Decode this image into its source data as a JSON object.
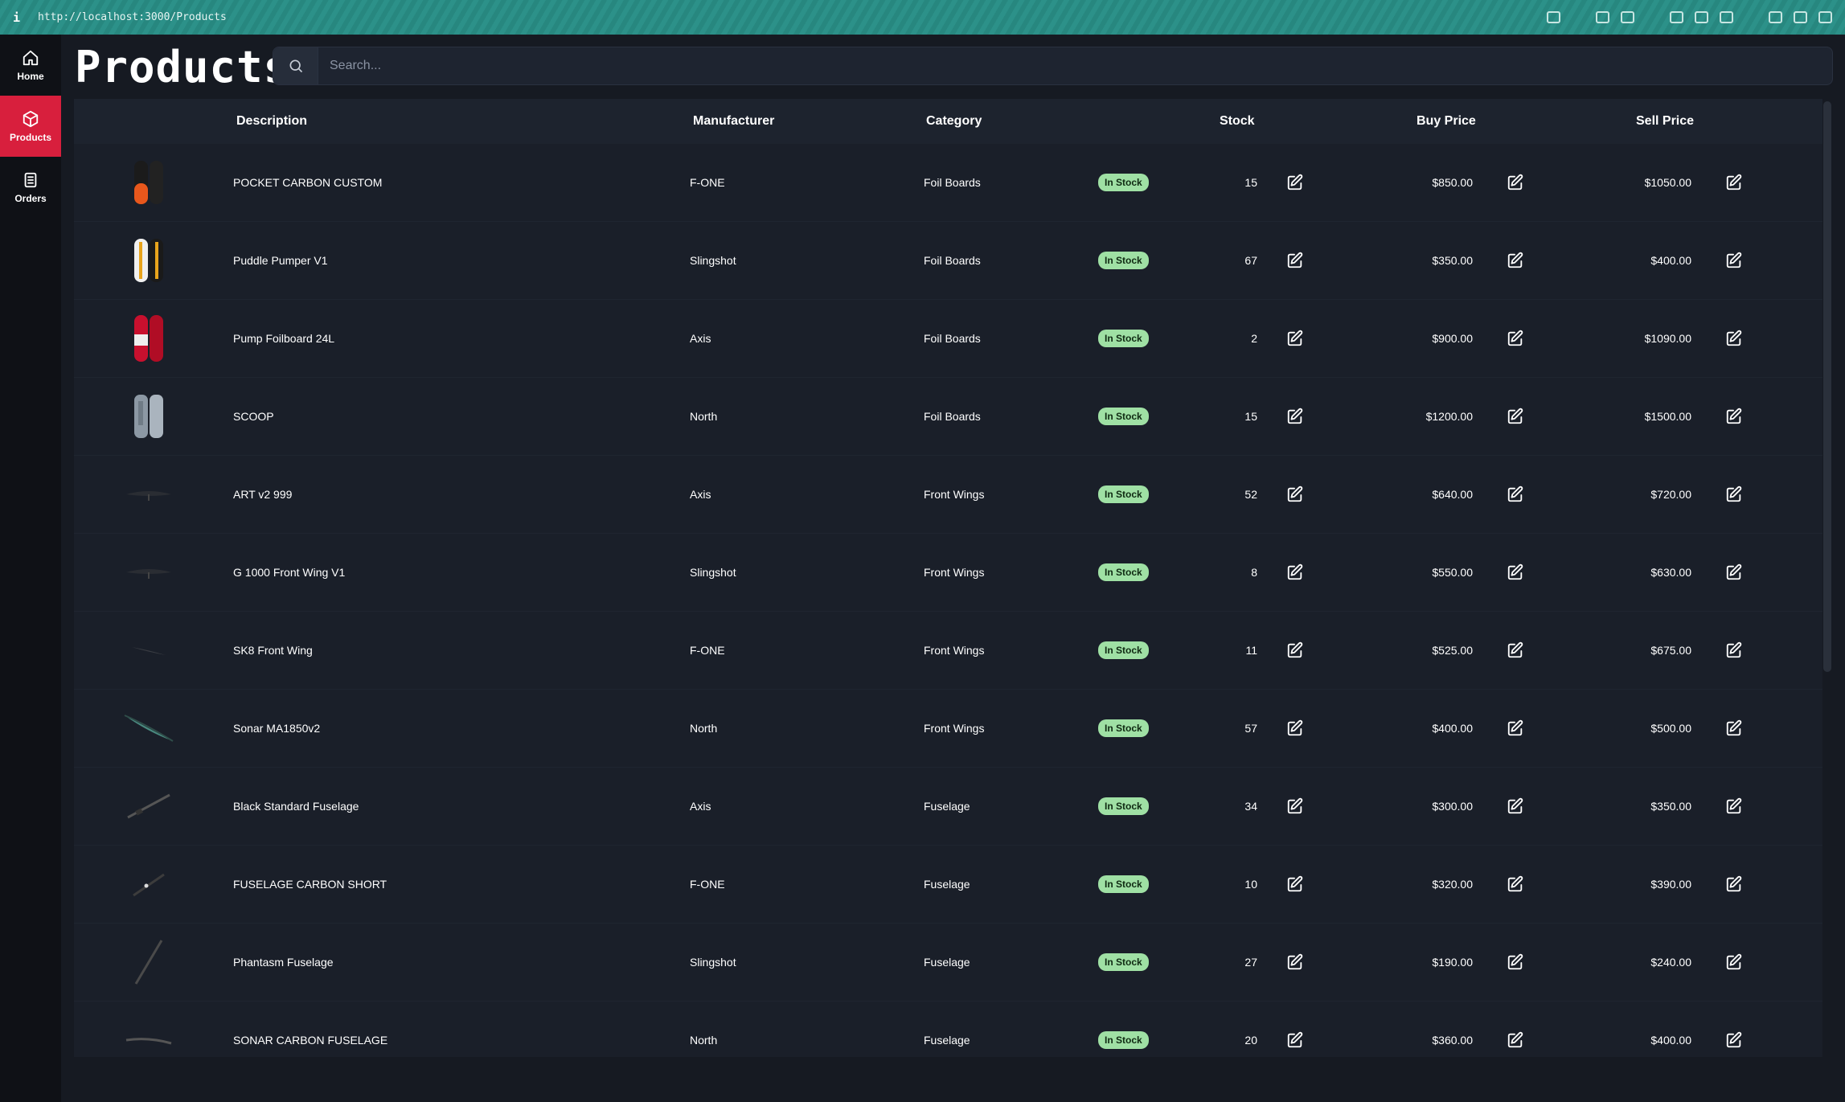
{
  "browser": {
    "info_icon": "i",
    "url": "http://localhost:3000/Products"
  },
  "sidebar": {
    "items": [
      {
        "label": "Home",
        "icon": "home-icon"
      },
      {
        "label": "Products",
        "icon": "box-icon"
      },
      {
        "label": "Orders",
        "icon": "document-list-icon"
      }
    ],
    "active_color": "#d81f3d"
  },
  "page": {
    "title": "Products"
  },
  "search": {
    "placeholder": "Search..."
  },
  "table": {
    "columns": [
      "Description",
      "Manufacturer",
      "Category",
      "Stock",
      "Buy Price",
      "Sell Price"
    ],
    "rows": [
      {
        "description": "POCKET CARBON CUSTOM",
        "manufacturer": "F-ONE",
        "category": "Foil Boards",
        "status": "In Stock",
        "stock": "15",
        "buy": "$850.00",
        "sell": "$1050.00",
        "thumb": "board-orange"
      },
      {
        "description": "Puddle Pumper V1",
        "manufacturer": "Slingshot",
        "category": "Foil Boards",
        "status": "In Stock",
        "stock": "67",
        "buy": "$350.00",
        "sell": "$400.00",
        "thumb": "board-yellow"
      },
      {
        "description": "Pump Foilboard 24L",
        "manufacturer": "Axis",
        "category": "Foil Boards",
        "status": "In Stock",
        "stock": "2",
        "buy": "$900.00",
        "sell": "$1090.00",
        "thumb": "board-red"
      },
      {
        "description": "SCOOP",
        "manufacturer": "North",
        "category": "Foil Boards",
        "status": "In Stock",
        "stock": "15",
        "buy": "$1200.00",
        "sell": "$1500.00",
        "thumb": "board-grey"
      },
      {
        "description": "ART v2 999",
        "manufacturer": "Axis",
        "category": "Front Wings",
        "status": "In Stock",
        "stock": "52",
        "buy": "$640.00",
        "sell": "$720.00",
        "thumb": "wing-dark"
      },
      {
        "description": "G 1000 Front Wing V1",
        "manufacturer": "Slingshot",
        "category": "Front Wings",
        "status": "In Stock",
        "stock": "8",
        "buy": "$550.00",
        "sell": "$630.00",
        "thumb": "wing-dark"
      },
      {
        "description": "SK8 Front Wing",
        "manufacturer": "F-ONE",
        "category": "Front Wings",
        "status": "In Stock",
        "stock": "11",
        "buy": "$525.00",
        "sell": "$675.00",
        "thumb": "wing-thin"
      },
      {
        "description": "Sonar MA1850v2",
        "manufacturer": "North",
        "category": "Front Wings",
        "status": "In Stock",
        "stock": "57",
        "buy": "$400.00",
        "sell": "$500.00",
        "thumb": "wing-teal"
      },
      {
        "description": "Black Standard Fuselage",
        "manufacturer": "Axis",
        "category": "Fuselage",
        "status": "In Stock",
        "stock": "34",
        "buy": "$300.00",
        "sell": "$350.00",
        "thumb": "fuselage"
      },
      {
        "description": "FUSELAGE CARBON SHORT",
        "manufacturer": "F-ONE",
        "category": "Fuselage",
        "status": "In Stock",
        "stock": "10",
        "buy": "$320.00",
        "sell": "$390.00",
        "thumb": "fuselage-short"
      },
      {
        "description": "Phantasm Fuselage",
        "manufacturer": "Slingshot",
        "category": "Fuselage",
        "status": "In Stock",
        "stock": "27",
        "buy": "$190.00",
        "sell": "$240.00",
        "thumb": "fuselage-long"
      },
      {
        "description": "SONAR CARBON FUSELAGE",
        "manufacturer": "North",
        "category": "Fuselage",
        "status": "In Stock",
        "stock": "20",
        "buy": "$360.00",
        "sell": "$400.00",
        "thumb": "fuselage-flat"
      }
    ],
    "badge_color": "#9fe0a4"
  }
}
